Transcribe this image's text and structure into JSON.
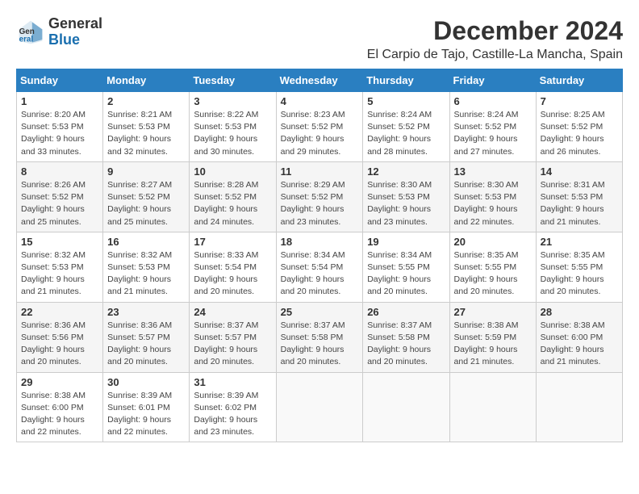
{
  "header": {
    "logo_line1": "General",
    "logo_line2": "Blue",
    "title": "December 2024",
    "subtitle": "El Carpio de Tajo, Castille-La Mancha, Spain"
  },
  "weekdays": [
    "Sunday",
    "Monday",
    "Tuesday",
    "Wednesday",
    "Thursday",
    "Friday",
    "Saturday"
  ],
  "weeks": [
    [
      {
        "day": "1",
        "info": "Sunrise: 8:20 AM\nSunset: 5:53 PM\nDaylight: 9 hours and 33 minutes."
      },
      {
        "day": "2",
        "info": "Sunrise: 8:21 AM\nSunset: 5:53 PM\nDaylight: 9 hours and 32 minutes."
      },
      {
        "day": "3",
        "info": "Sunrise: 8:22 AM\nSunset: 5:53 PM\nDaylight: 9 hours and 30 minutes."
      },
      {
        "day": "4",
        "info": "Sunrise: 8:23 AM\nSunset: 5:52 PM\nDaylight: 9 hours and 29 minutes."
      },
      {
        "day": "5",
        "info": "Sunrise: 8:24 AM\nSunset: 5:52 PM\nDaylight: 9 hours and 28 minutes."
      },
      {
        "day": "6",
        "info": "Sunrise: 8:24 AM\nSunset: 5:52 PM\nDaylight: 9 hours and 27 minutes."
      },
      {
        "day": "7",
        "info": "Sunrise: 8:25 AM\nSunset: 5:52 PM\nDaylight: 9 hours and 26 minutes."
      }
    ],
    [
      {
        "day": "8",
        "info": "Sunrise: 8:26 AM\nSunset: 5:52 PM\nDaylight: 9 hours and 25 minutes."
      },
      {
        "day": "9",
        "info": "Sunrise: 8:27 AM\nSunset: 5:52 PM\nDaylight: 9 hours and 25 minutes."
      },
      {
        "day": "10",
        "info": "Sunrise: 8:28 AM\nSunset: 5:52 PM\nDaylight: 9 hours and 24 minutes."
      },
      {
        "day": "11",
        "info": "Sunrise: 8:29 AM\nSunset: 5:52 PM\nDaylight: 9 hours and 23 minutes."
      },
      {
        "day": "12",
        "info": "Sunrise: 8:30 AM\nSunset: 5:53 PM\nDaylight: 9 hours and 23 minutes."
      },
      {
        "day": "13",
        "info": "Sunrise: 8:30 AM\nSunset: 5:53 PM\nDaylight: 9 hours and 22 minutes."
      },
      {
        "day": "14",
        "info": "Sunrise: 8:31 AM\nSunset: 5:53 PM\nDaylight: 9 hours and 21 minutes."
      }
    ],
    [
      {
        "day": "15",
        "info": "Sunrise: 8:32 AM\nSunset: 5:53 PM\nDaylight: 9 hours and 21 minutes."
      },
      {
        "day": "16",
        "info": "Sunrise: 8:32 AM\nSunset: 5:53 PM\nDaylight: 9 hours and 21 minutes."
      },
      {
        "day": "17",
        "info": "Sunrise: 8:33 AM\nSunset: 5:54 PM\nDaylight: 9 hours and 20 minutes."
      },
      {
        "day": "18",
        "info": "Sunrise: 8:34 AM\nSunset: 5:54 PM\nDaylight: 9 hours and 20 minutes."
      },
      {
        "day": "19",
        "info": "Sunrise: 8:34 AM\nSunset: 5:55 PM\nDaylight: 9 hours and 20 minutes."
      },
      {
        "day": "20",
        "info": "Sunrise: 8:35 AM\nSunset: 5:55 PM\nDaylight: 9 hours and 20 minutes."
      },
      {
        "day": "21",
        "info": "Sunrise: 8:35 AM\nSunset: 5:55 PM\nDaylight: 9 hours and 20 minutes."
      }
    ],
    [
      {
        "day": "22",
        "info": "Sunrise: 8:36 AM\nSunset: 5:56 PM\nDaylight: 9 hours and 20 minutes."
      },
      {
        "day": "23",
        "info": "Sunrise: 8:36 AM\nSunset: 5:57 PM\nDaylight: 9 hours and 20 minutes."
      },
      {
        "day": "24",
        "info": "Sunrise: 8:37 AM\nSunset: 5:57 PM\nDaylight: 9 hours and 20 minutes."
      },
      {
        "day": "25",
        "info": "Sunrise: 8:37 AM\nSunset: 5:58 PM\nDaylight: 9 hours and 20 minutes."
      },
      {
        "day": "26",
        "info": "Sunrise: 8:37 AM\nSunset: 5:58 PM\nDaylight: 9 hours and 20 minutes."
      },
      {
        "day": "27",
        "info": "Sunrise: 8:38 AM\nSunset: 5:59 PM\nDaylight: 9 hours and 21 minutes."
      },
      {
        "day": "28",
        "info": "Sunrise: 8:38 AM\nSunset: 6:00 PM\nDaylight: 9 hours and 21 minutes."
      }
    ],
    [
      {
        "day": "29",
        "info": "Sunrise: 8:38 AM\nSunset: 6:00 PM\nDaylight: 9 hours and 22 minutes."
      },
      {
        "day": "30",
        "info": "Sunrise: 8:39 AM\nSunset: 6:01 PM\nDaylight: 9 hours and 22 minutes."
      },
      {
        "day": "31",
        "info": "Sunrise: 8:39 AM\nSunset: 6:02 PM\nDaylight: 9 hours and 23 minutes."
      },
      null,
      null,
      null,
      null
    ]
  ]
}
